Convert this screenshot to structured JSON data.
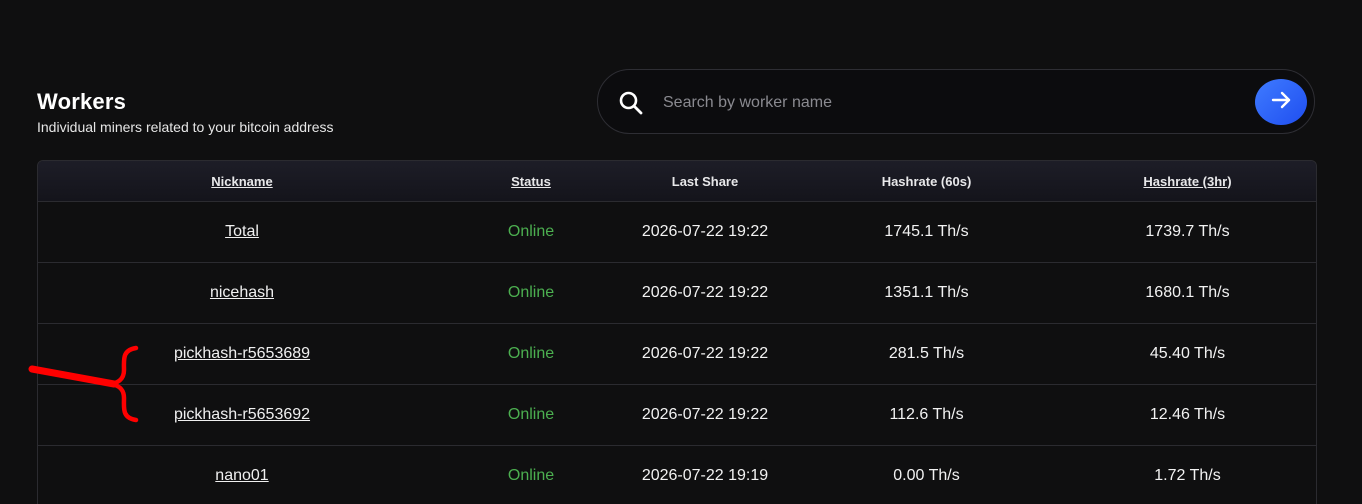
{
  "header": {
    "title": "Workers",
    "subtitle": "Individual miners related to your bitcoin address"
  },
  "search": {
    "placeholder": "Search by worker name",
    "value": "",
    "icon": "search-icon",
    "submit_icon": "arrow-right-icon"
  },
  "table": {
    "columns": [
      "Nickname",
      "Status",
      "Last Share",
      "Hashrate (60s)",
      "Hashrate (3hr)"
    ],
    "rows": [
      {
        "nickname": "Total",
        "status": "Online",
        "last_share": "2026-07-22 19:22",
        "hashrate_60s": "1745.1 Th/s",
        "hashrate_3hr": "1739.7 Th/s"
      },
      {
        "nickname": "nicehash",
        "status": "Online",
        "last_share": "2026-07-22 19:22",
        "hashrate_60s": "1351.1 Th/s",
        "hashrate_3hr": "1680.1 Th/s"
      },
      {
        "nickname": "pickhash-r5653689",
        "status": "Online",
        "last_share": "2026-07-22 19:22",
        "hashrate_60s": "281.5 Th/s",
        "hashrate_3hr": "45.40 Th/s"
      },
      {
        "nickname": "pickhash-r5653692",
        "status": "Online",
        "last_share": "2026-07-22 19:22",
        "hashrate_60s": "112.6 Th/s",
        "hashrate_3hr": "12.46 Th/s"
      },
      {
        "nickname": "nano01",
        "status": "Online",
        "last_share": "2026-07-22 19:19",
        "hashrate_60s": "0.00 Th/s",
        "hashrate_3hr": "1.72 Th/s"
      }
    ]
  },
  "colors": {
    "background": "#0f0f10",
    "accent": "#2f63ff",
    "online": "#4caf50",
    "annotation": "#ff0000"
  }
}
